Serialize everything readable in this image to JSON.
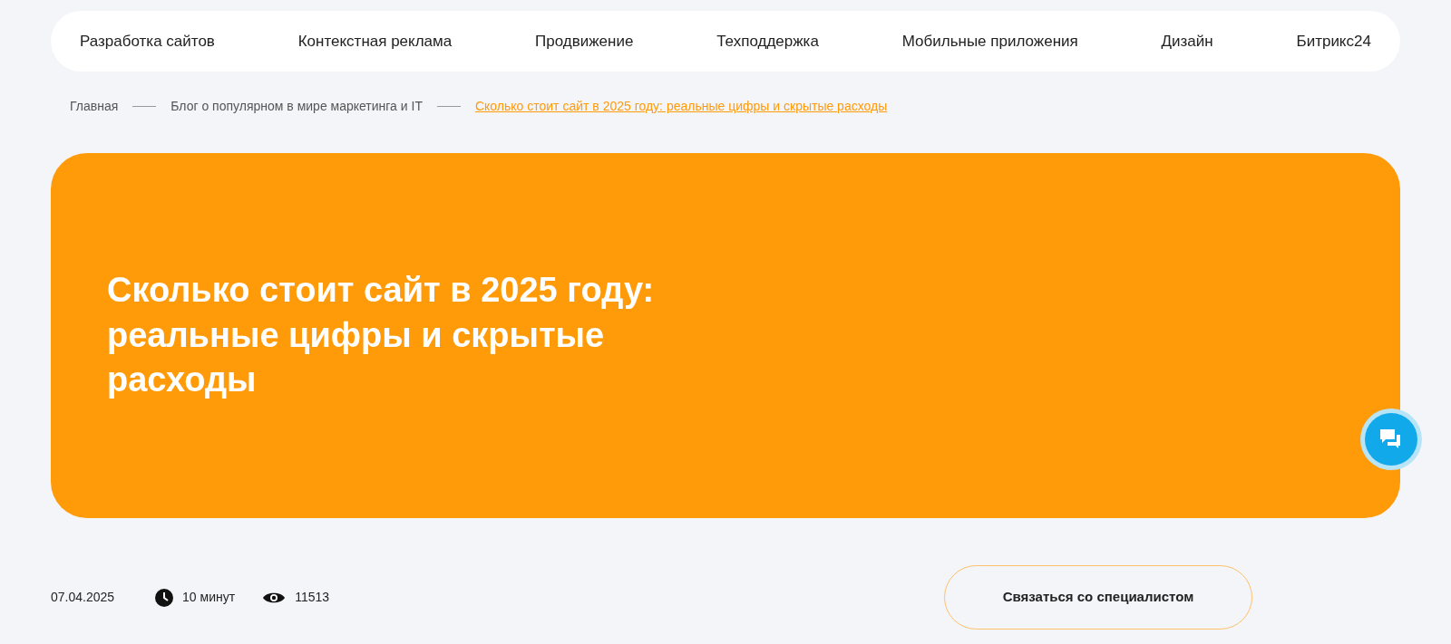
{
  "nav": {
    "items": [
      {
        "label": "Разработка сайтов"
      },
      {
        "label": "Контекстная реклама"
      },
      {
        "label": "Продвижение"
      },
      {
        "label": "Техподдержка"
      },
      {
        "label": "Мобильные приложения"
      },
      {
        "label": "Дизайн"
      },
      {
        "label": "Битрикс24"
      }
    ]
  },
  "breadcrumbs": [
    {
      "label": "Главная",
      "current": false
    },
    {
      "label": "Блог о популярном в мире маркетинга и IT",
      "current": false
    },
    {
      "label": "Сколько стоит сайт в 2025 году: реальные цифры и скрытые расходы",
      "current": true
    }
  ],
  "hero": {
    "title": "Сколько стоит сайт в 2025 году: реальные цифры и скрытые расходы"
  },
  "meta": {
    "date": "07.04.2025",
    "read_time": "10 минут",
    "views": "11513"
  },
  "contact_button": "Связаться со специалистом"
}
